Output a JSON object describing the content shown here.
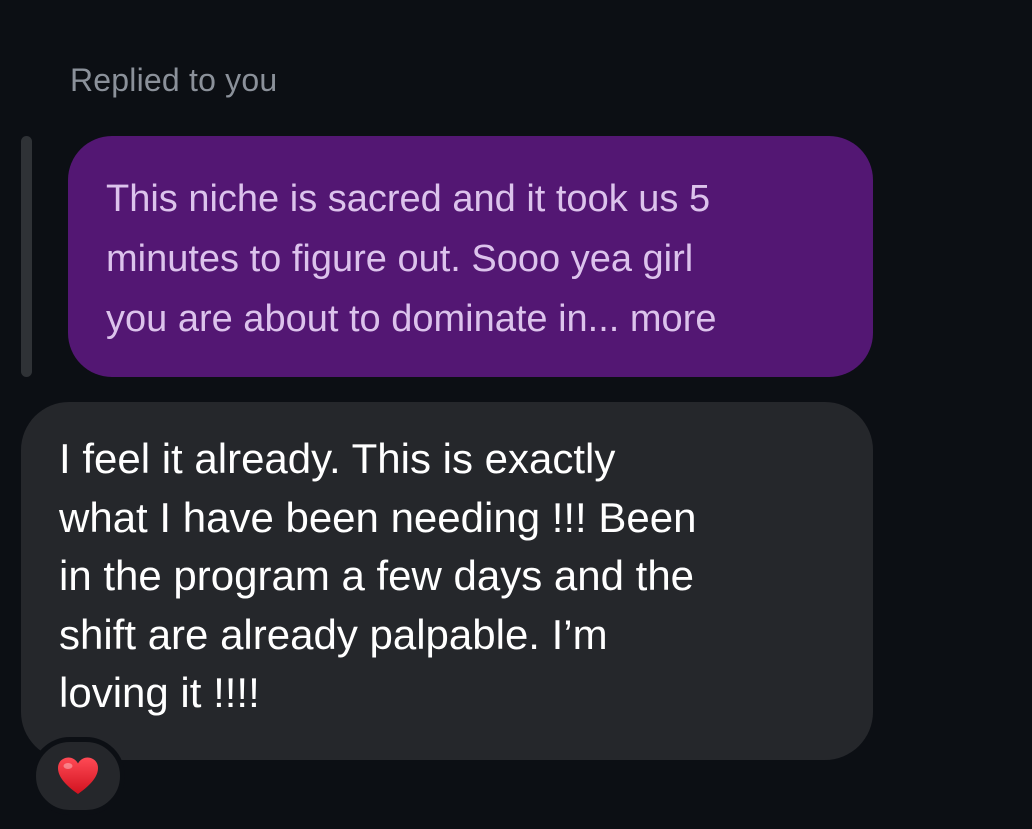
{
  "reply_context": {
    "label": "Replied to you"
  },
  "quoted_message": {
    "lines": [
      "This niche is sacred and it took us 5",
      "minutes to figure out. Sooo yea girl",
      "you are about to dominate in..."
    ],
    "more_label": "more",
    "bubble_color": "#531773",
    "text_color": "#dcc3ec"
  },
  "message": {
    "lines": [
      "I feel it already. This is exactly",
      "what I have been needing !!! Been",
      "in the program a few days and the",
      "shift are already palpable. I’m",
      "loving it !!!!"
    ],
    "bubble_color": "#25272b",
    "text_color": "#ffffff"
  },
  "reaction": {
    "icon": "red-heart-icon",
    "color": "#e8202f"
  },
  "colors": {
    "background": "#0c0f14",
    "muted_text": "#8b919a"
  }
}
